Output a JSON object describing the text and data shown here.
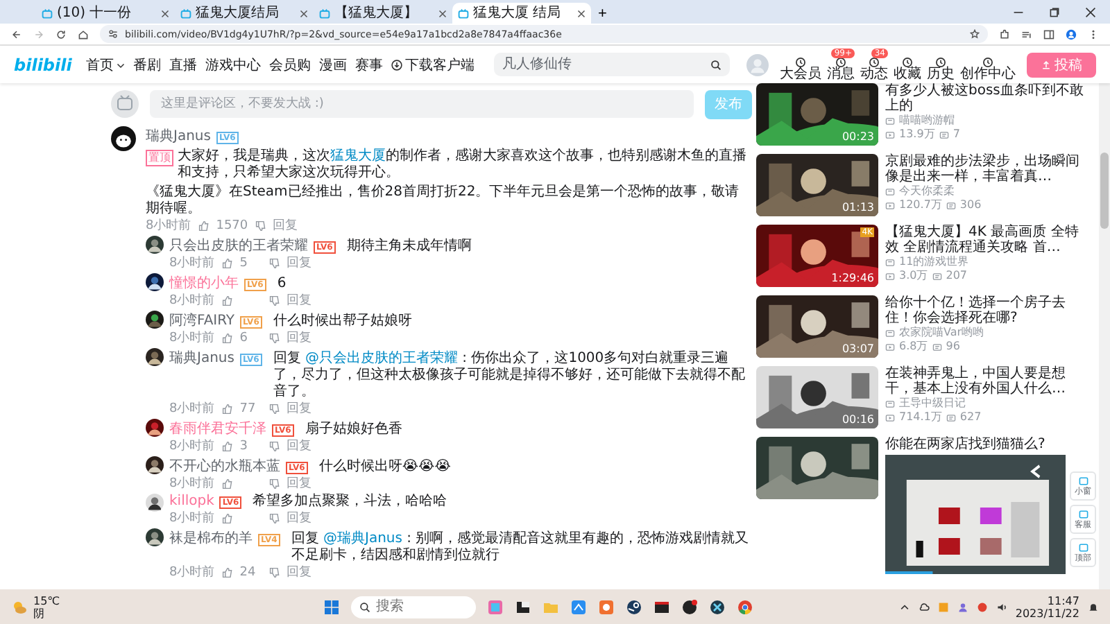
{
  "browser": {
    "tabs": [
      {
        "title": "(10) 十一份",
        "selected": false
      },
      {
        "title": "猛鬼大厦结局",
        "selected": false
      },
      {
        "title": "【猛鬼大厦】",
        "selected": false
      },
      {
        "title": "猛鬼大厦 结局",
        "selected": true
      }
    ],
    "new_tab": "+",
    "url": "bilibili.com/video/BV1dg4y1U7hR/?p=2&vd_source=e54e9a17a1bcd2a8e7847a4ffaac36e"
  },
  "header": {
    "logo": "bilibili",
    "nav": [
      {
        "label": "首页",
        "caret": true
      },
      {
        "label": "番剧",
        "caret": false
      },
      {
        "label": "直播",
        "caret": false
      },
      {
        "label": "游戏中心",
        "caret": false
      },
      {
        "label": "会员购",
        "caret": false
      },
      {
        "label": "漫画",
        "caret": false
      },
      {
        "label": "赛事",
        "caret": false
      },
      {
        "label": "下载客户端",
        "caret": false
      }
    ],
    "search": {
      "placeholder": "凡人修仙传"
    },
    "actions": [
      {
        "label": "大会员"
      },
      {
        "label": "消息",
        "badge": "99+"
      },
      {
        "label": "动态",
        "badge": "34"
      },
      {
        "label": "收藏"
      },
      {
        "label": "历史"
      },
      {
        "label": "创作中心"
      }
    ],
    "upload_button": "投稿"
  },
  "comment_box": {
    "placeholder": "这里是评论区，不要发大战 :)",
    "submit": "发布"
  },
  "main_comment": {
    "user": "瑞典Janus",
    "badge": {
      "text": "LV6",
      "color": "#5fb4e8"
    },
    "tag": "置顶",
    "text_before": "大家好，我是瑞典，这次",
    "link": "猛鬼大厦",
    "text_after": "的制作者，感谢大家喜欢这个故事，也特别感谢木鱼的直播和支持，只希望大家这次玩得开心。",
    "second_paragraph": "《猛鬼大厦》在Steam已经推出，售价28首周打折22。下半年元旦会是第一个恐怖的故事，敬请期待喔。",
    "time": "8小时前",
    "likes": "1570",
    "reply": "回复"
  },
  "replies": [
    {
      "user": "只会出皮肤的王者荣耀",
      "vip": false,
      "badge": {
        "text": "LV6",
        "color": "#f0503c"
      },
      "text": "期待主角未成年情啊",
      "time": "8小时前",
      "likes": "5",
      "reply": "回复"
    },
    {
      "user": "憧憬的小年",
      "vip": true,
      "badge": {
        "text": "LV6",
        "color": "#f0a04a"
      },
      "text": "6",
      "time": "8小时前",
      "reply": "回复"
    },
    {
      "user": "阿湾FAIRY",
      "vip": false,
      "badge": {
        "text": "LV6",
        "color": "#f0a04a"
      },
      "text": "什么时候出帮子姑娘呀",
      "time": "8小时前",
      "likes": "6",
      "reply": "回复"
    },
    {
      "user": "瑞典Janus",
      "vip": false,
      "badge": {
        "text": "LV6",
        "color": "#5fb4e8"
      },
      "reply_prefix": "回复",
      "reply_to": "@只会出皮肤的王者荣耀",
      "text": " : 伤你出众了，这1000多句对白就重录三遍了，尽力了，但这种太极像孩子可能就是掉得不够好，还可能做下去就得不配音了。",
      "time": "8小时前",
      "likes": "77",
      "reply": "回复"
    },
    {
      "user": "春雨伴君安千泽",
      "vip": true,
      "badge": {
        "text": "LV6",
        "color": "#f0503c"
      },
      "text": "扇子姑娘好色香",
      "time": "8小时前",
      "likes": "3",
      "reply": "回复"
    },
    {
      "user": "不开心的水瓶本蓝",
      "vip": false,
      "badge": {
        "text": "LV6",
        "color": "#f0503c"
      },
      "text": "什么时候出呀😭😭😭",
      "time": "8小时前",
      "reply": "回复"
    },
    {
      "user": "killopk",
      "vip": true,
      "badge": {
        "text": "LV6",
        "color": "#f0503c"
      },
      "text": "希望多加点聚聚，斗法，哈哈哈",
      "time": "8小时前",
      "reply": "回复"
    },
    {
      "user": "袜是棉布的羊",
      "vip": false,
      "badge": {
        "text": "LV4",
        "color": "#f0a04a"
      },
      "reply_prefix": "回复",
      "reply_to": "@瑞典Janus",
      "text": " : 别啊，感觉最清配音这就里有趣的，恐怖游戏剧情就又不足刷卡，结因感和剧情到位就行",
      "time": "8小时前",
      "likes": "24",
      "reply": "回复"
    }
  ],
  "related": [
    {
      "title": "有多少人被这boss血条吓到不敢上的",
      "uploader": "喵喵哟游帽",
      "views": "13.9万",
      "danmaku": "7",
      "duration": "00:23"
    },
    {
      "title": "京剧最难的步法梁步，出场瞬间像是出来一样，丰富着真…",
      "uploader": "今天你柔柔",
      "views": "120.7万",
      "danmaku": "306",
      "duration": "01:13"
    },
    {
      "title": "【猛鬼大厦】4K 最高画质 全特效 全剧情流程通关攻略 首…",
      "uploader": "11的游戏世界",
      "views": "3.0万",
      "danmaku": "207",
      "duration": "1:29:46",
      "badge": "4K"
    },
    {
      "title": "给你十个亿！选择一个房子去住！你会选择死在哪?",
      "uploader": "农家院喵Var哟哟",
      "views": "6.8万",
      "danmaku": "96",
      "duration": "03:07"
    },
    {
      "title": "在装神弄鬼上，中国人要是想干，基本上没有外国人什么…",
      "uploader": "王导中级日记",
      "views": "714.1万",
      "danmaku": "627",
      "duration": "00:16"
    },
    {
      "title": "你能在两家店找到猫猫么?"
    }
  ],
  "side_buttons": [
    "小窗",
    "客服",
    "顶部"
  ],
  "taskbar": {
    "weather": {
      "temp": "15℃",
      "desc": "阴"
    },
    "search": {
      "placeholder": "搜索"
    },
    "time": "11:47",
    "date": "2023/11/22"
  }
}
